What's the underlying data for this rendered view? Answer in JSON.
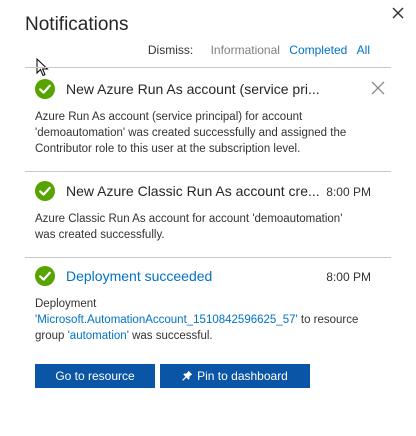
{
  "panel": {
    "title": "Notifications",
    "close_icon": "close-icon"
  },
  "dismiss": {
    "label": "Dismiss:",
    "informational": "Informational",
    "completed": "Completed",
    "all": "All"
  },
  "notifications": [
    {
      "icon": "success-check-icon",
      "title": "New Azure Run As account (service pri...",
      "time": "",
      "line1": "Azure Run As account (service principal) for account",
      "line2": "'demoautomation' was created successfully and assigned the",
      "line3": "Contributor role to this user at the subscription level."
    },
    {
      "icon": "success-check-icon",
      "title": "New Azure Classic Run As account cre...",
      "time": "8:00 PM",
      "line1": "Azure Classic Run As account for account 'demoautomation'",
      "line2": "was created successfully."
    },
    {
      "icon": "success-check-icon",
      "title": "Deployment succeeded",
      "time": "8:00 PM",
      "line1": "Deployment",
      "resource_link": "'Microsoft.AutomationAccount_1510842596625_57'",
      "line2_suffix": " to resource",
      "line3_prefix": "group ",
      "group_link": "'automation'",
      "line3_suffix": " was successful."
    }
  ],
  "buttons": {
    "go_to_resource": "Go to resource",
    "pin_to_dashboard": "Pin to dashboard"
  },
  "colors": {
    "accent": "#0072c6",
    "button": "#0a55a5",
    "success": "#57a300"
  }
}
